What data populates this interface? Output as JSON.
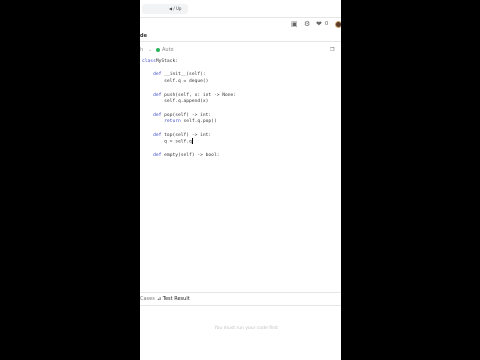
{
  "browser": {
    "url_fragment": "◀ / Up"
  },
  "toolbar": {
    "like_count": "0"
  },
  "editor_tab": {
    "label": "de"
  },
  "editor_header": {
    "language_short": "h",
    "mode_label": "Auto"
  },
  "code_lines": [
    {
      "kind": "plain",
      "segments": [
        [
          "kw",
          "class"
        ],
        [
          "",
          "MyStack:"
        ]
      ]
    },
    {
      "kind": "blank"
    },
    {
      "kind": "plain",
      "segments": [
        [
          "",
          "    "
        ],
        [
          "kw",
          "def"
        ],
        [
          "",
          " __init__(self):"
        ]
      ]
    },
    {
      "kind": "plain",
      "segments": [
        [
          "",
          "        self.q = deque()"
        ]
      ]
    },
    {
      "kind": "blank"
    },
    {
      "kind": "plain",
      "segments": [
        [
          "",
          "    "
        ],
        [
          "kw",
          "def"
        ],
        [
          "",
          " push(self, x: int -> None:"
        ]
      ]
    },
    {
      "kind": "plain",
      "segments": [
        [
          "",
          "        self.q.append(x)"
        ]
      ]
    },
    {
      "kind": "blank"
    },
    {
      "kind": "plain",
      "segments": [
        [
          "",
          "    "
        ],
        [
          "kw",
          "def"
        ],
        [
          "",
          " pop(self) -> int:"
        ]
      ]
    },
    {
      "kind": "plain",
      "segments": [
        [
          "",
          "        "
        ],
        [
          "kw",
          "return"
        ],
        [
          "",
          " self.q.pop()"
        ]
      ]
    },
    {
      "kind": "blank"
    },
    {
      "kind": "plain",
      "segments": [
        [
          "",
          "    "
        ],
        [
          "kw",
          "def"
        ],
        [
          "",
          " top(self) -> int:"
        ]
      ]
    },
    {
      "kind": "plain",
      "segments": [
        [
          "",
          "        q = self.q"
        ]
      ],
      "cursor": true
    },
    {
      "kind": "blank"
    },
    {
      "kind": "plain",
      "segments": [
        [
          "",
          "    "
        ],
        [
          "kw",
          "def"
        ],
        [
          "",
          " empty(self) -> bool:"
        ]
      ]
    }
  ],
  "bottom_panel": {
    "left_tab": "Cases",
    "right_tab": "Test Result",
    "placeholder": "You must run your code first"
  }
}
